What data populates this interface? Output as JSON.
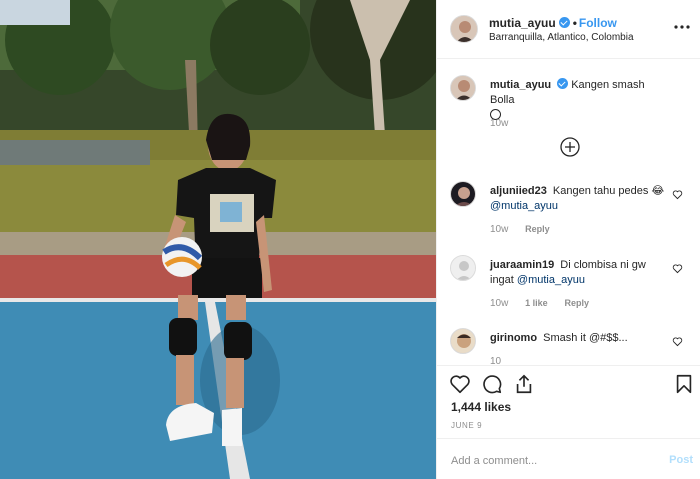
{
  "post": {
    "image_alt": "Woman in black t-shirt holding a volleyball on a blue court",
    "photo_colors": {
      "court": "#3d8bb5",
      "red_band": "#b5544c",
      "grass": "#8a8a3a",
      "sky_trees": "#3b4a2a"
    }
  },
  "header": {
    "username": "mutia_ayuu",
    "separator": "•",
    "follow_label": "Follow",
    "location": "Barranquilla, Atlantico, Colombia"
  },
  "caption": {
    "username": "mutia_ayuu",
    "text": "Kangen smash Bolla",
    "time": "10w"
  },
  "comments": [
    {
      "username": "aljuniied23",
      "text": "Kangen tahu pedes 😂",
      "mention": "@mutia_ayuu",
      "time": "10w",
      "likes": "",
      "reply": "Reply"
    },
    {
      "username": "juaraamin19",
      "text": "Di clombisa ni gw ingat",
      "mention": "@mutia_ayuu",
      "time": "10w",
      "likes": "1 like",
      "reply": "Reply"
    },
    {
      "username": "girinomo",
      "text": "Smash it @#$$...",
      "mention": "",
      "time": "10",
      "likes": "",
      "reply": ""
    }
  ],
  "stats": {
    "likes": "1,444 likes",
    "date": "JUNE 9"
  },
  "composer": {
    "placeholder": "Add a comment...",
    "post_label": "Post"
  },
  "colors": {
    "link_blue": "#3897f0",
    "post_disabled": "#b2dffc",
    "muted": "#8e8e8e"
  }
}
